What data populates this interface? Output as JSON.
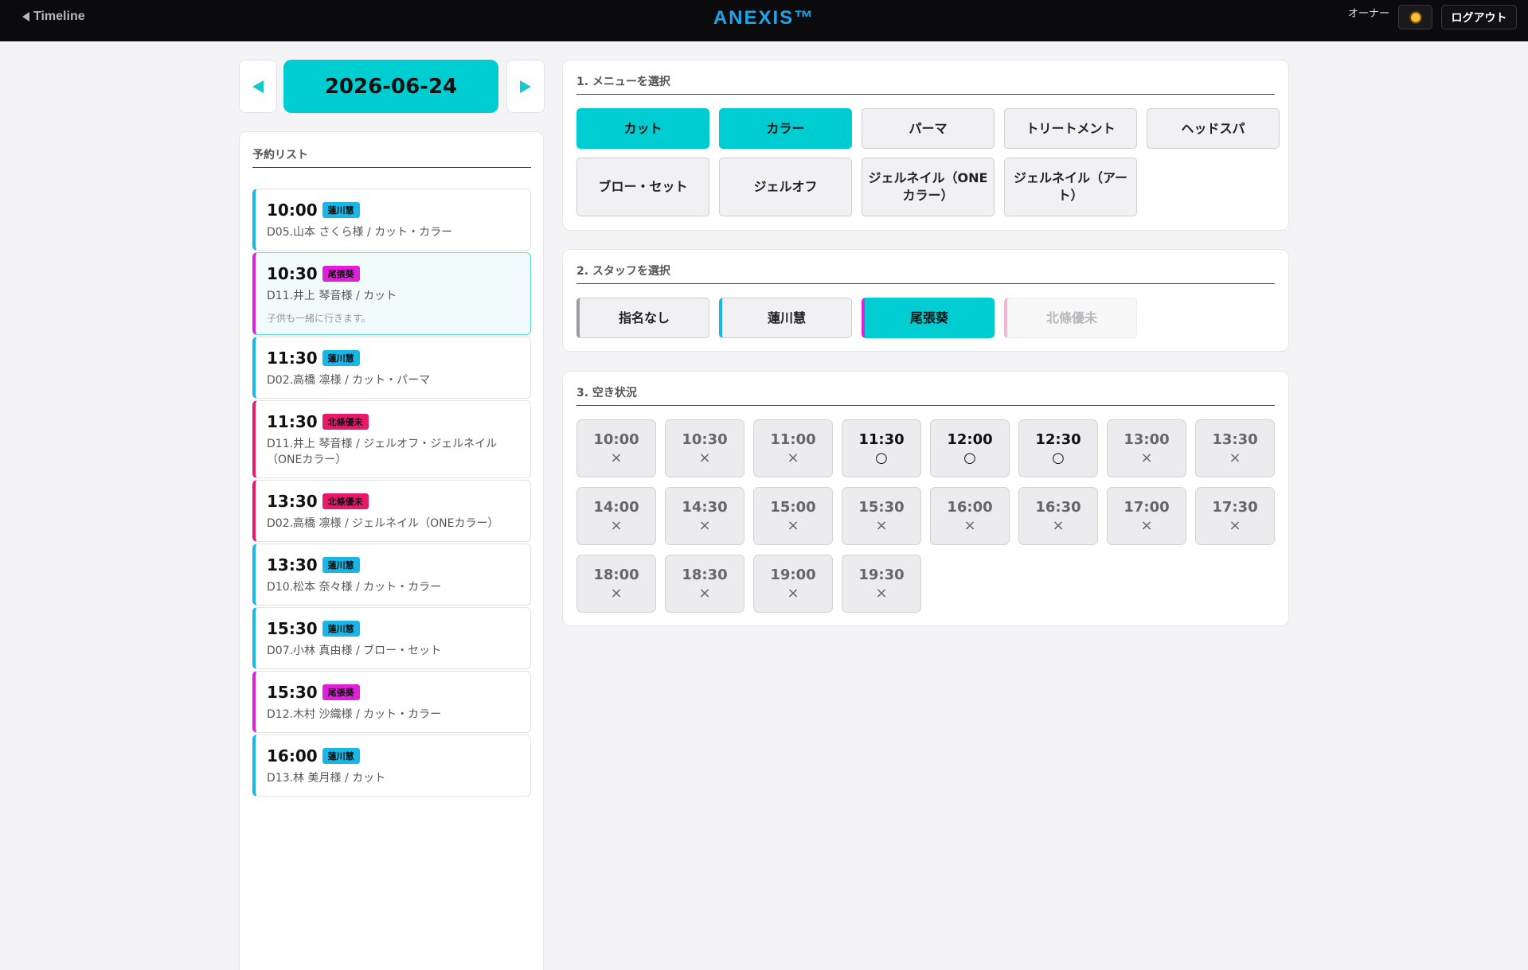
{
  "header": {
    "back_label": "Timeline",
    "brand": "ANEXIS™",
    "role": "オーナー",
    "logout_label": "ログアウト"
  },
  "date_nav": {
    "date": "2026-06-24"
  },
  "reservations": {
    "title": "予約リスト",
    "items": [
      {
        "time": "10:00",
        "staff": "蓮川慧",
        "desc": "D05.山本 さくら様 / カット・カラー"
      },
      {
        "time": "10:30",
        "staff": "尾張葵",
        "desc": "D11.井上 琴音様 / カット",
        "note": "子供も一緒に行きます。"
      },
      {
        "time": "11:30",
        "staff": "蓮川慧",
        "desc": "D02.高橋 凛様 / カット・パーマ"
      },
      {
        "time": "11:30",
        "staff": "北條優未",
        "desc": "D11.井上 琴音様 / ジェルオフ・ジェルネイル（ONEカラー）"
      },
      {
        "time": "13:30",
        "staff": "北條優未",
        "desc": "D02.高橋 凛様 / ジェルネイル（ONEカラー）"
      },
      {
        "time": "13:30",
        "staff": "蓮川慧",
        "desc": "D10.松本 奈々様 / カット・カラー"
      },
      {
        "time": "15:30",
        "staff": "蓮川慧",
        "desc": "D07.小林 真由様 / ブロー・セット"
      },
      {
        "time": "15:30",
        "staff": "尾張葵",
        "desc": "D12.木村 沙織様 / カット・カラー"
      },
      {
        "time": "16:00",
        "staff": "蓮川慧",
        "desc": "D13.林 美月様 / カット"
      }
    ]
  },
  "menu": {
    "title": "1. メニューを選択",
    "items": [
      "カット",
      "カラー",
      "パーマ",
      "トリートメント",
      "ヘッドスパ",
      "ブロー・セット",
      "ジェルオフ",
      "ジェルネイル（ONEカラー）",
      "ジェルネイル（アート）"
    ],
    "selected": [
      "カット",
      "カラー"
    ]
  },
  "staff": {
    "title": "2. スタッフを選択",
    "items": [
      "指名なし",
      "蓮川慧",
      "尾張葵",
      "北條優未"
    ],
    "selected": "尾張葵",
    "disabled": [
      "北條優未"
    ]
  },
  "availability": {
    "title": "3. 空き状況",
    "slots": [
      {
        "time": "10:00",
        "mark": "×"
      },
      {
        "time": "10:30",
        "mark": "×"
      },
      {
        "time": "11:00",
        "mark": "×"
      },
      {
        "time": "11:30",
        "mark": "○"
      },
      {
        "time": "12:00",
        "mark": "○"
      },
      {
        "time": "12:30",
        "mark": "○"
      },
      {
        "time": "13:00",
        "mark": "×"
      },
      {
        "time": "13:30",
        "mark": "×"
      },
      {
        "time": "14:00",
        "mark": "×"
      },
      {
        "time": "14:30",
        "mark": "×"
      },
      {
        "time": "15:00",
        "mark": "×"
      },
      {
        "time": "15:30",
        "mark": "×"
      },
      {
        "time": "16:00",
        "mark": "×"
      },
      {
        "time": "16:30",
        "mark": "×"
      },
      {
        "time": "17:00",
        "mark": "×"
      },
      {
        "time": "17:30",
        "mark": "×"
      },
      {
        "time": "18:00",
        "mark": "×"
      },
      {
        "time": "18:30",
        "mark": "×"
      },
      {
        "time": "19:00",
        "mark": "×"
      },
      {
        "time": "19:30",
        "mark": "×"
      }
    ]
  },
  "colors": {
    "accent": "#00cdd1",
    "staff_hasukawa": "#19b6e8",
    "staff_owari": "#e020d8",
    "staff_hojo": "#e8186a",
    "staff_none": "#9a9aa0",
    "header_bg": "#0b0b0d",
    "brand": "#1aa7ec"
  },
  "icons": {
    "back": "triangle-left-icon",
    "theme": "sun-icon",
    "prev": "triangle-left-icon",
    "next": "triangle-right-icon"
  }
}
